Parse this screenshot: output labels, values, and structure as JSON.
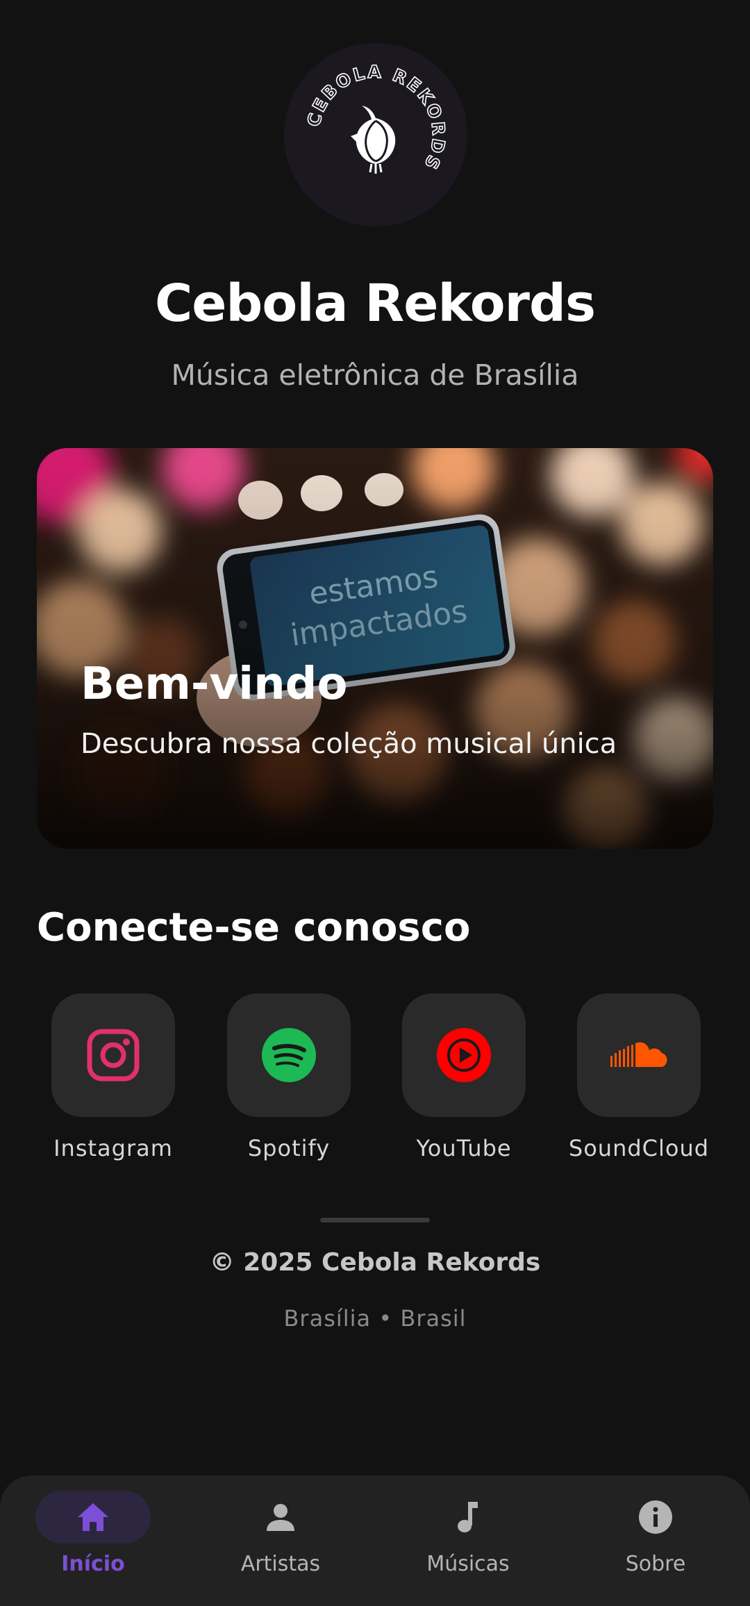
{
  "header": {
    "logo_text": "CEBOLA REKORDS",
    "title": "Cebola Rekords",
    "subtitle": "Música eletrônica de Brasília"
  },
  "hero": {
    "phone_text_line1": "estamos",
    "phone_text_line2": "impactados",
    "title": "Bem-vindo",
    "subtitle": "Descubra nossa coleção musical única"
  },
  "social": {
    "title": "Conecte-se conosco",
    "links": [
      {
        "label": "Instagram",
        "icon": "instagram-icon",
        "color": "#e1306c"
      },
      {
        "label": "Spotify",
        "icon": "spotify-icon",
        "color": "#1db954"
      },
      {
        "label": "YouTube",
        "icon": "youtube-icon",
        "color": "#ff0000"
      },
      {
        "label": "SoundCloud",
        "icon": "soundcloud-icon",
        "color": "#ff5500"
      }
    ]
  },
  "footer": {
    "copyright": "© 2025 Cebola Rekords",
    "location": "Brasília • Brasil"
  },
  "nav": {
    "active_color": "#7c4fd6",
    "items": [
      {
        "label": "Início",
        "icon": "home-icon",
        "active": true
      },
      {
        "label": "Artistas",
        "icon": "person-icon",
        "active": false
      },
      {
        "label": "Músicas",
        "icon": "music-note-icon",
        "active": false
      },
      {
        "label": "Sobre",
        "icon": "info-icon",
        "active": false
      }
    ]
  }
}
